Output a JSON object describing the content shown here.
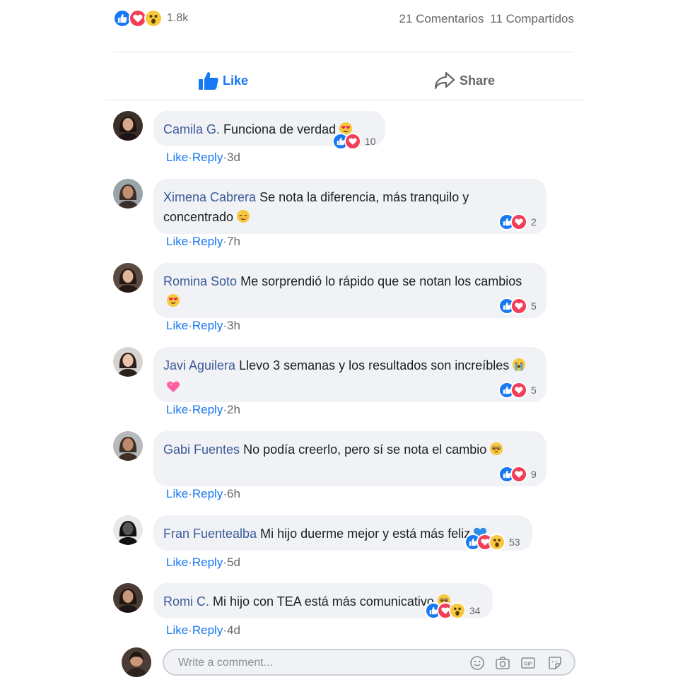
{
  "post": {
    "reaction_count": "1.8k",
    "comments_count": "21 Comentarios",
    "shares_count": "11 Compartidos",
    "colors": {
      "like": "#1877f2",
      "love": "#f33e58",
      "wow": "#f7c83c",
      "name": "#3c5a99"
    }
  },
  "actions": {
    "like": "Like",
    "share": "Share"
  },
  "labels": {
    "like": "Like",
    "reply": "Reply",
    "dot": "·"
  },
  "comments": [
    {
      "author": "Camila G.",
      "text": "Funciona de verdad",
      "emoji": [
        "heart-eyes"
      ],
      "reactions": [
        "like",
        "love"
      ],
      "count": "10",
      "time": "3d"
    },
    {
      "author": "Ximena Cabrera",
      "text": "Se nota la diferencia, más tranquilo y concentrado",
      "emoji": [
        "relieved"
      ],
      "reactions": [
        "like",
        "love"
      ],
      "count": "2",
      "time": "7h"
    },
    {
      "author": "Romina Soto",
      "text": "Me sorprendió lo rápido que se notan los cambios",
      "emoji": [
        "heart-eyes"
      ],
      "reactions": [
        "like",
        "love"
      ],
      "count": "5",
      "time": "3h"
    },
    {
      "author": "Javi Aguilera",
      "text": "Llevo 3 semanas y los resultados son increíbles",
      "emoji": [
        "crying",
        "pink-heart"
      ],
      "reactions": [
        "like",
        "love"
      ],
      "count": "5",
      "time": "2h"
    },
    {
      "author": "Gabi Fuentes",
      "text": "No podía creerlo, pero sí se nota el cambio",
      "emoji": [
        "pleading"
      ],
      "reactions": [
        "like",
        "love"
      ],
      "count": "9",
      "time": "6h"
    },
    {
      "author": "Fran Fuentealba",
      "text": "Mi hijo duerme mejor y está más feliz",
      "emoji": [
        "blue-heart"
      ],
      "reactions": [
        "like",
        "love",
        "wow"
      ],
      "count": "53",
      "time": "5d"
    },
    {
      "author": "Romi C.",
      "text": "Mi hijo con TEA está más comunicativo",
      "emoji": [
        "pleading"
      ],
      "reactions": [
        "like",
        "love",
        "wow"
      ],
      "count": "34",
      "time": "4d"
    }
  ],
  "composer": {
    "placeholder": "Write a comment..."
  }
}
